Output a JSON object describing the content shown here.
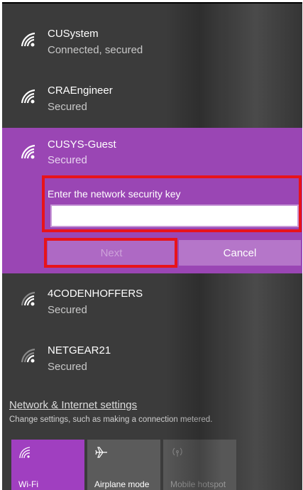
{
  "networks": [
    {
      "name": "CUSystem",
      "status": "Connected, secured"
    },
    {
      "name": "CRAEngineer",
      "status": "Secured"
    },
    {
      "name": "CUSYS-Guest",
      "status": "Secured"
    },
    {
      "name": "4CODENHOFFERS",
      "status": "Secured"
    },
    {
      "name": "NETGEAR21",
      "status": "Secured"
    }
  ],
  "connect_form": {
    "prompt": "Enter the network security key",
    "key_value": "",
    "next_label": "Next",
    "cancel_label": "Cancel"
  },
  "settings": {
    "link": "Network & Internet settings",
    "description": "Change settings, such as making a connection metered."
  },
  "quick_actions": [
    {
      "label": "Wi-Fi",
      "icon": "wifi-icon",
      "state": "on"
    },
    {
      "label": "Airplane mode",
      "icon": "airplane-icon",
      "state": "off"
    },
    {
      "label": "Mobile hotspot",
      "icon": "hotspot-icon",
      "state": "disabled"
    }
  ],
  "colors": {
    "panel_bg": "#3b3b3b",
    "accent": "#9a46b4",
    "highlight_border": "#e8131a"
  }
}
